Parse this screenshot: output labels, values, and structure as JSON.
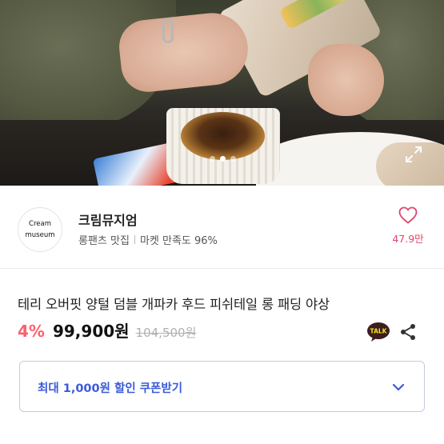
{
  "hero": {
    "active_slide": 1,
    "slide_count": 3
  },
  "shop": {
    "logo_line1": "Cream",
    "logo_line2": "museum",
    "name": "크림뮤지엄",
    "tagline": "롱팬츠 맛집",
    "satisfaction": "마켓 만족도 96%",
    "like_count": "47.9만"
  },
  "product": {
    "title": "테리 오버핏 양털 덤블 개파카 후드 피쉬테일 롱 패딩 야상",
    "discount": "4%",
    "price": "99,900원",
    "original_price": "104,500원"
  },
  "coupon": {
    "label": "최대 1,000원 할인 쿠폰받기"
  },
  "colors": {
    "discount": "#ff5f6d",
    "heart": "#e2476a",
    "coupon_text": "#3a5bd9"
  }
}
